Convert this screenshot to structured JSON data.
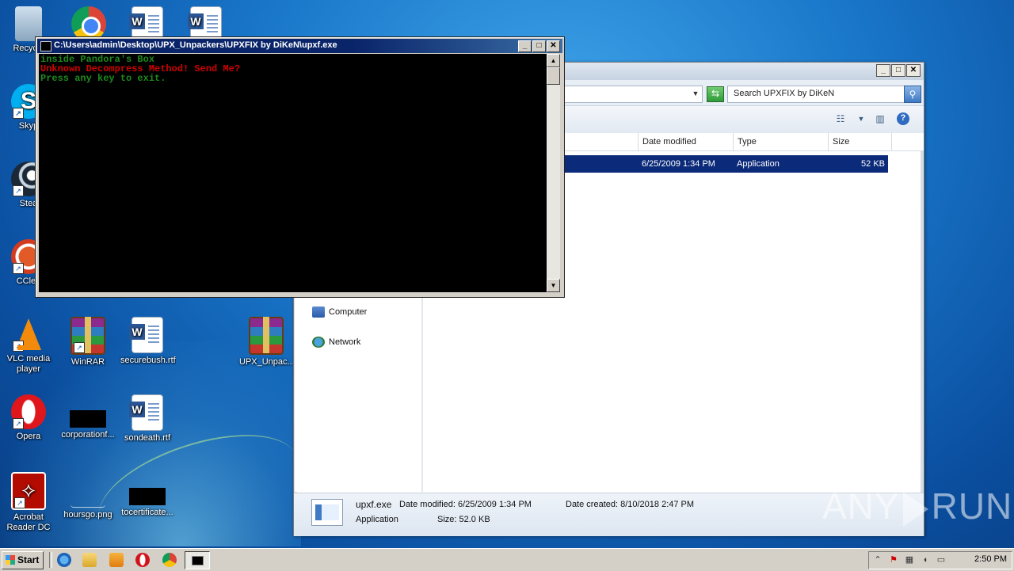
{
  "desktop": {
    "icons": [
      {
        "label": "Recycle",
        "icon": "recycle-bin-icon"
      },
      {
        "label": "",
        "icon": "chrome-icon"
      },
      {
        "label": "",
        "icon": "word-document-icon"
      },
      {
        "label": "",
        "icon": "word-document-icon"
      },
      {
        "label": "Skyp",
        "icon": "skype-icon"
      },
      {
        "label": "Stea",
        "icon": "steam-icon"
      },
      {
        "label": "CClea",
        "icon": "ccleaner-icon"
      },
      {
        "label": "VLC media player",
        "icon": "vlc-icon"
      },
      {
        "label": "WinRAR",
        "icon": "winrar-icon"
      },
      {
        "label": "securebush.rtf",
        "icon": "word-document-icon"
      },
      {
        "label": "UPX_Unpac...",
        "icon": "winrar-icon"
      },
      {
        "label": "Opera",
        "icon": "opera-icon"
      },
      {
        "label": "corporationf...",
        "icon": "blank-file-icon"
      },
      {
        "label": "sondeath.rtf",
        "icon": "word-document-icon"
      },
      {
        "label": "Acrobat Reader DC",
        "icon": "acrobat-icon"
      },
      {
        "label": "hoursgo.png",
        "icon": "image-file-icon"
      },
      {
        "label": "tocertificate...",
        "icon": "blank-file-icon"
      }
    ]
  },
  "console": {
    "title": "C:\\Users\\admin\\Desktop\\UPX_Unpackers\\UPXFIX by DiKeN\\upxf.exe",
    "lines": [
      {
        "text": "inside Pandora's Box",
        "color": "#1d8a1d"
      },
      {
        "text": "Unknown Decompress Method! Send Me?",
        "color": "#d00000"
      },
      {
        "text": "Press any key to exit.",
        "color": "#1d8a1d"
      }
    ]
  },
  "explorer": {
    "search_placeholder": "Search UPXFIX by DiKeN",
    "columns": [
      "Date modified",
      "Type",
      "Size"
    ],
    "file_row": {
      "date_modified": "6/25/2009 1:34 PM",
      "type": "Application",
      "size": "52 KB"
    },
    "nav": [
      "Computer",
      "Network"
    ],
    "details": {
      "name": "upxf.exe",
      "date_modified_label": "Date modified: 6/25/2009 1:34 PM",
      "date_created_label": "Date created: 8/10/2018 2:47 PM",
      "type": "Application",
      "size_label": "Size: 52.0 KB"
    }
  },
  "taskbar": {
    "start_label": "Start",
    "clock": "2:50 PM"
  },
  "watermark": {
    "left": "ANY",
    "right": "RUN"
  }
}
